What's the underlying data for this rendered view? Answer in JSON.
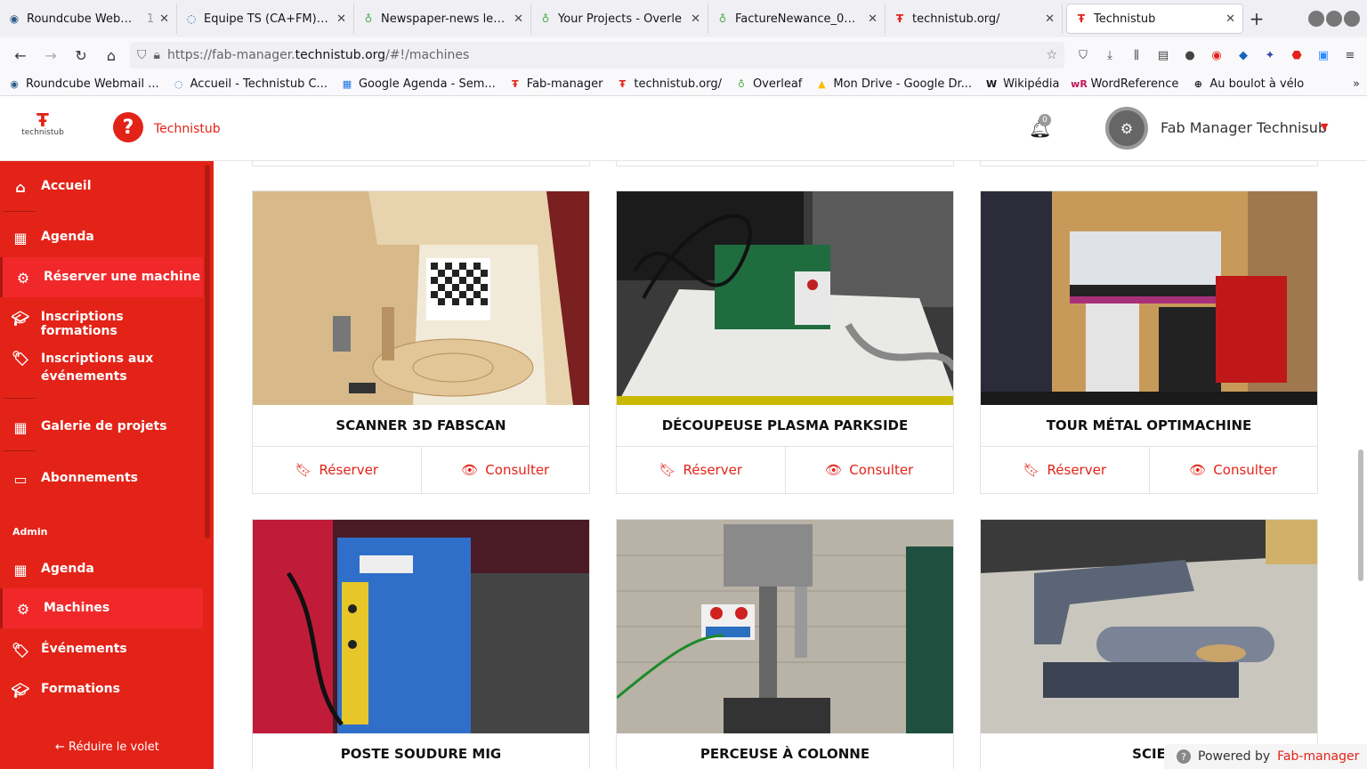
{
  "browser": {
    "tabs": [
      {
        "label": "Roundcube Webmail",
        "extra": "1",
        "icon": "roundcube-icon"
      },
      {
        "label": "Equipe TS (CA+FM) - Te",
        "icon": "nextcloud-icon"
      },
      {
        "label": "Newspaper-news lette",
        "icon": "overleaf-icon"
      },
      {
        "label": "Your Projects - Overle",
        "icon": "overleaf-icon"
      },
      {
        "label": "FactureNewance_09_0",
        "icon": "overleaf-icon"
      },
      {
        "label": "technistub.org/",
        "icon": "technistub-icon"
      },
      {
        "label": "Technistub",
        "icon": "technistub-icon",
        "active": true
      }
    ],
    "url": {
      "prefix": "https://fab-manager.",
      "domain": "technistub.org",
      "path": "/#!/machines"
    },
    "bookmarks": [
      "Roundcube Webmail ...",
      "Accueil - Technistub C...",
      "Google Agenda - Sem...",
      "Fab-manager",
      "technistub.org/",
      "Overleaf",
      "Mon Drive - Google Dr...",
      "Wikipédia",
      "WordReference",
      "Au boulot à vélo"
    ]
  },
  "header": {
    "logo_text": "technistub",
    "brand": "Technistub",
    "notifications": "0",
    "user_name": "Fab Manager Technisub"
  },
  "sidebar": {
    "items": [
      {
        "label": "Accueil",
        "icon": "home-icon"
      },
      {
        "label": "Agenda",
        "icon": "calendar-icon"
      },
      {
        "label": "Réserver une machine",
        "icon": "cogs-icon",
        "selected": true
      },
      {
        "label": "Inscriptions formations",
        "icon": "graduation-cap-icon"
      },
      {
        "label": "Inscriptions aux événements",
        "icon": "tags-icon"
      },
      {
        "label": "Galerie de projets",
        "icon": "grid-icon"
      },
      {
        "label": "Abonnements",
        "icon": "credit-card-icon"
      }
    ],
    "admin_label": "Admin",
    "admin_items": [
      {
        "label": "Agenda",
        "icon": "calendar-icon"
      },
      {
        "label": "Machines",
        "icon": "cogs-icon",
        "selected": true
      },
      {
        "label": "Événements",
        "icon": "tags-icon"
      },
      {
        "label": "Formations",
        "icon": "graduation-cap-icon"
      }
    ],
    "collapse_label": "← Réduire le volet"
  },
  "machines": [
    {
      "title": "SCANNER 3D FABSCAN",
      "reserve": "Réserver",
      "consult": "Consulter"
    },
    {
      "title": "DÉCOUPEUSE PLASMA PARKSIDE",
      "reserve": "Réserver",
      "consult": "Consulter"
    },
    {
      "title": "TOUR MÉTAL OPTIMACHINE",
      "reserve": "Réserver",
      "consult": "Consulter"
    },
    {
      "title": "POSTE SOUDURE MIG"
    },
    {
      "title": "PERCEUSE À COLONNE"
    },
    {
      "title": "SCIE"
    }
  ],
  "footer": {
    "powered_by": "Powered by",
    "powered_link": "Fab-manager"
  },
  "colors": {
    "brand_red": "#e32318"
  }
}
